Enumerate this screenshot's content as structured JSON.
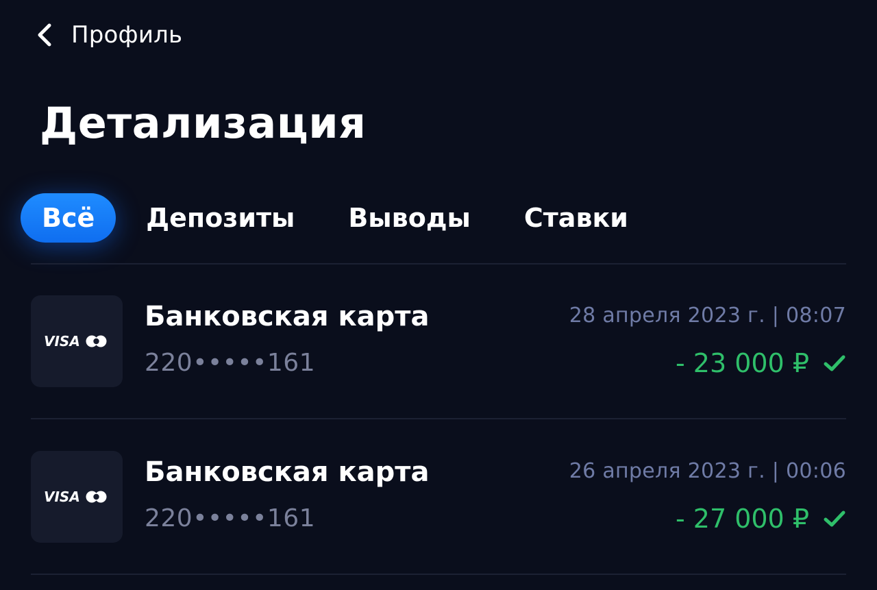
{
  "header": {
    "back_label": "Профиль",
    "title": "Детализация"
  },
  "tabs": [
    {
      "label": "Всё",
      "active": true
    },
    {
      "label": "Депозиты",
      "active": false
    },
    {
      "label": "Выводы",
      "active": false
    },
    {
      "label": "Ставки",
      "active": false
    }
  ],
  "transactions": [
    {
      "method": "Банковская карта",
      "card_number": "220•••••161",
      "date": "28 апреля 2023 г. | 08:07",
      "amount": "- 23 000 ₽",
      "status": "success",
      "logo_text": "VISA"
    },
    {
      "method": "Банковская карта",
      "card_number": "220•••••161",
      "date": "26 апреля 2023 г. | 00:06",
      "amount": "- 27 000 ₽",
      "status": "success",
      "logo_text": "VISA"
    }
  ],
  "icons": {
    "back": "chevron-left-icon",
    "card_logo": "visa-mastercard-icon",
    "status": "checkmark-icon"
  },
  "colors": {
    "background": "#0a0e1c",
    "accent": "#1a80ff",
    "amount": "#2fbf6a",
    "muted_text": "#7b819b",
    "date_text": "#6f7ba6"
  }
}
